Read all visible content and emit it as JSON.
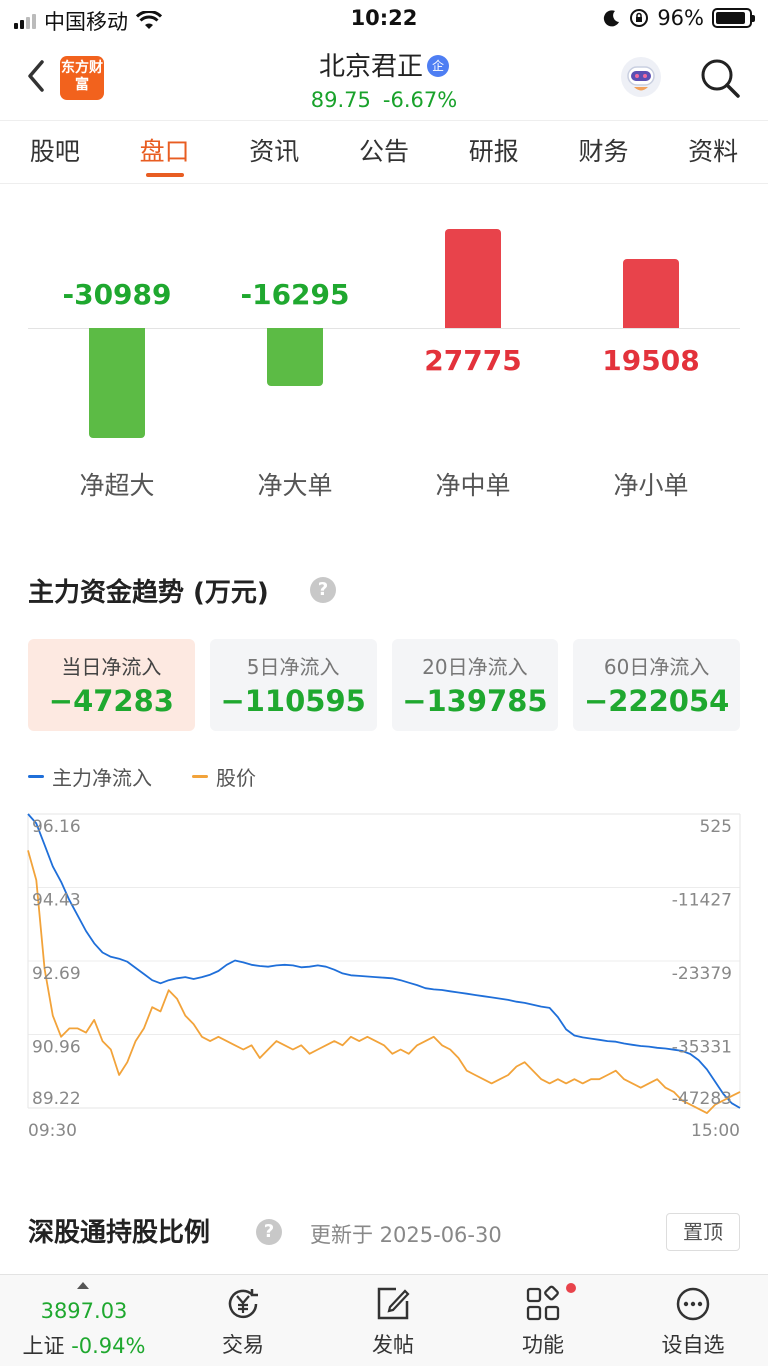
{
  "status_bar": {
    "carrier": "中国移动",
    "time": "10:22",
    "battery": "96%"
  },
  "header": {
    "logo_text": "东方财富",
    "stock_name": "北京君正",
    "badge": "企",
    "price": "89.75",
    "change_pct": "-6.67%",
    "icons": [
      "back-icon",
      "robot-assistant-icon",
      "search-icon"
    ]
  },
  "tabs": [
    {
      "label": "股吧",
      "active": false
    },
    {
      "label": "盘口",
      "active": true
    },
    {
      "label": "资讯",
      "active": false
    },
    {
      "label": "公告",
      "active": false
    },
    {
      "label": "研报",
      "active": false
    },
    {
      "label": "财务",
      "active": false
    },
    {
      "label": "资料",
      "active": false
    }
  ],
  "flow": {
    "items": [
      {
        "label": "净超大",
        "value": "-30989",
        "num": -30989
      },
      {
        "label": "净大单",
        "value": "-16295",
        "num": -16295
      },
      {
        "label": "净中单",
        "value": "27775",
        "num": 27775
      },
      {
        "label": "净小单",
        "value": "19508",
        "num": 19508
      }
    ],
    "colors": {
      "positive": "#e8434b",
      "negative": "#5cbb45"
    }
  },
  "trend": {
    "title": "主力资金趋势 (万元)",
    "help_icon": "?",
    "periods": [
      {
        "label": "当日净流入",
        "value": "−47283",
        "active": true
      },
      {
        "label": "5日净流入",
        "value": "−110595",
        "active": false
      },
      {
        "label": "20日净流入",
        "value": "−139785",
        "active": false
      },
      {
        "label": "60日净流入",
        "value": "−222054",
        "active": false
      }
    ],
    "legend": [
      {
        "name": "主力净流入",
        "color": "#1f6fd9"
      },
      {
        "name": "股价",
        "color": "#f2a33a"
      }
    ]
  },
  "chart_data": {
    "type": "line",
    "x_range": [
      "09:30",
      "15:00"
    ],
    "y_left_ticks": [
      "96.16",
      "94.43",
      "92.69",
      "90.96",
      "89.22"
    ],
    "y_right_ticks": [
      "525",
      "-11427",
      "-23379",
      "-35331",
      "-47283"
    ],
    "y_left_lim": [
      89.22,
      96.16
    ],
    "y_right_lim": [
      -47283,
      525
    ],
    "grid": true,
    "series": [
      {
        "name": "主力净流入",
        "axis": "right",
        "color": "#1f6fd9",
        "values": [
          525,
          -1000,
          -4500,
          -8000,
          -10500,
          -13500,
          -16000,
          -18500,
          -20500,
          -22000,
          -22700,
          -23000,
          -23500,
          -24500,
          -25500,
          -26500,
          -27000,
          -26500,
          -26200,
          -26000,
          -26300,
          -26000,
          -25600,
          -25000,
          -24000,
          -23300,
          -23600,
          -24000,
          -24200,
          -24300,
          -24100,
          -24000,
          -24100,
          -24400,
          -24300,
          -24100,
          -24300,
          -24800,
          -25400,
          -25700,
          -25800,
          -25900,
          -26000,
          -26100,
          -26200,
          -26500,
          -26900,
          -27300,
          -27800,
          -28000,
          -28100,
          -28300,
          -28500,
          -28700,
          -28900,
          -29100,
          -29300,
          -29500,
          -29700,
          -30000,
          -30200,
          -30500,
          -30800,
          -31000,
          -32500,
          -34500,
          -35500,
          -35800,
          -36000,
          -36200,
          -36400,
          -36500,
          -36800,
          -37000,
          -37200,
          -37300,
          -37500,
          -37600,
          -37800,
          -38000,
          -38500,
          -39500,
          -41000,
          -43000,
          -45000,
          -46500,
          -47283
        ]
      },
      {
        "name": "股价",
        "axis": "left",
        "color": "#f2a33a",
        "values": [
          95.3,
          94.6,
          92.5,
          91.4,
          90.9,
          91.1,
          91.1,
          91.0,
          91.3,
          90.8,
          90.6,
          90.0,
          90.3,
          90.8,
          91.1,
          91.6,
          91.5,
          92.0,
          91.8,
          91.4,
          91.2,
          90.9,
          90.8,
          90.9,
          90.8,
          90.7,
          90.6,
          90.7,
          90.4,
          90.6,
          90.8,
          90.7,
          90.6,
          90.7,
          90.5,
          90.6,
          90.7,
          90.8,
          90.7,
          90.9,
          90.8,
          90.9,
          90.8,
          90.7,
          90.5,
          90.6,
          90.5,
          90.7,
          90.8,
          90.9,
          90.7,
          90.6,
          90.4,
          90.1,
          90.0,
          89.9,
          89.8,
          89.9,
          90.0,
          90.2,
          90.3,
          90.1,
          89.9,
          89.8,
          89.9,
          89.8,
          89.9,
          89.8,
          89.9,
          89.9,
          90.0,
          90.1,
          89.9,
          89.8,
          89.7,
          89.8,
          89.9,
          89.7,
          89.6,
          89.4,
          89.3,
          89.2,
          89.1,
          89.3,
          89.4,
          89.5,
          89.6
        ]
      }
    ]
  },
  "holding": {
    "title": "深股通持股比例",
    "updated": "更新于 2025-06-30",
    "pin_button": "置顶"
  },
  "bottom_nav": {
    "index_value": "3897.03",
    "index_name": "上证",
    "index_change": "-0.94%",
    "items": [
      {
        "label": "交易",
        "icon": "trade-yen-icon"
      },
      {
        "label": "发帖",
        "icon": "post-edit-icon"
      },
      {
        "label": "功能",
        "icon": "functions-grid-icon"
      },
      {
        "label": "设自选",
        "icon": "more-dots-icon"
      }
    ]
  }
}
